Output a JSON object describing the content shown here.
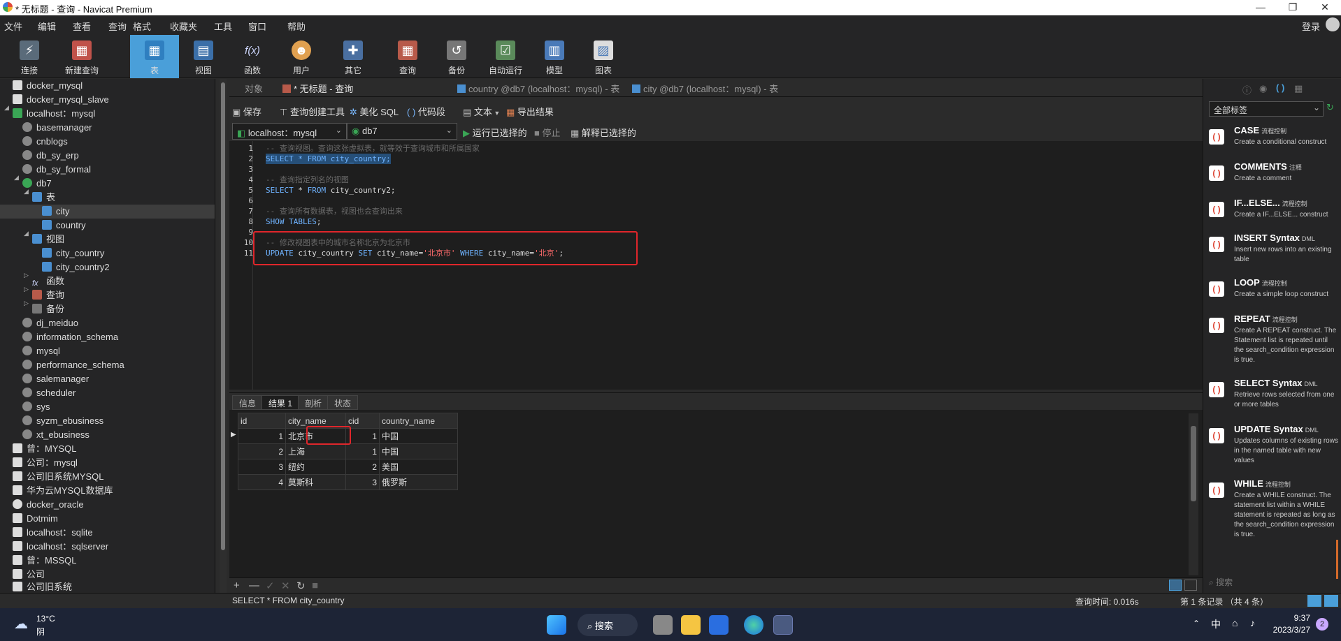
{
  "window": {
    "title": "* 无标题 - 查询 - Navicat Premium",
    "controls": [
      "—",
      "❐",
      "✕"
    ]
  },
  "menubar": {
    "items": [
      "文件",
      "编辑",
      "查看",
      "查询",
      "格式",
      "收藏夹",
      "工具",
      "窗口",
      "帮助"
    ],
    "login": "登录"
  },
  "toolbar": {
    "items": [
      {
        "label": "连接",
        "icon": "plug-icon"
      },
      {
        "label": "新建查询",
        "icon": "new-query-icon"
      },
      {
        "label": "表",
        "icon": "table-icon"
      },
      {
        "label": "视图",
        "icon": "view-icon"
      },
      {
        "label": "函数",
        "icon": "function-icon",
        "glyph": "f(x)"
      },
      {
        "label": "用户",
        "icon": "user-icon"
      },
      {
        "label": "其它",
        "icon": "tools-icon"
      },
      {
        "label": "查询",
        "icon": "query-icon"
      },
      {
        "label": "备份",
        "icon": "backup-icon"
      },
      {
        "label": "自动运行",
        "icon": "automation-icon"
      },
      {
        "label": "模型",
        "icon": "model-icon"
      },
      {
        "label": "图表",
        "icon": "chart-icon"
      }
    ]
  },
  "sidebar": {
    "items": [
      {
        "label": "docker_mysql"
      },
      {
        "label": "docker_mysql_slave"
      },
      {
        "label": "localhost：mysql"
      },
      {
        "label": "basemanager"
      },
      {
        "label": "cnblogs"
      },
      {
        "label": "db_sy_erp"
      },
      {
        "label": "db_sy_formal"
      },
      {
        "label": "db7"
      },
      {
        "label": "表"
      },
      {
        "label": "city"
      },
      {
        "label": "country"
      },
      {
        "label": "视图"
      },
      {
        "label": "city_country"
      },
      {
        "label": "city_country2"
      },
      {
        "label": "函数"
      },
      {
        "label": "查询"
      },
      {
        "label": "备份"
      },
      {
        "label": "dj_meiduo"
      },
      {
        "label": "information_schema"
      },
      {
        "label": "mysql"
      },
      {
        "label": "performance_schema"
      },
      {
        "label": "salemanager"
      },
      {
        "label": "scheduler"
      },
      {
        "label": "sys"
      },
      {
        "label": "syzm_ebusiness"
      },
      {
        "label": "xt_ebusiness"
      },
      {
        "label": "曾：MYSQL"
      },
      {
        "label": "公司：mysql"
      },
      {
        "label": "公司旧系统MYSQL"
      },
      {
        "label": "华为云MYSQL数据库"
      },
      {
        "label": "docker_oracle"
      },
      {
        "label": "Dotmim"
      },
      {
        "label": "localhost：sqlite"
      },
      {
        "label": "localhost：sqlserver"
      },
      {
        "label": "曾：MSSQL"
      },
      {
        "label": "公司"
      },
      {
        "label": "公司旧系统"
      }
    ]
  },
  "tabs": {
    "objects": "对象",
    "query": "* 无标题 - 查询",
    "country": "country @db7 (localhost：mysql) - 表",
    "city": "city @db7 (localhost：mysql) - 表"
  },
  "editor_toolbar": {
    "save": "保存",
    "query_builder": "查询创建工具",
    "beautify": "美化 SQL",
    "snippet": "代码段",
    "text": "文本",
    "export": "导出结果"
  },
  "connection_bar": {
    "connection": "localhost：mysql",
    "database": "db7",
    "run_selected": "运行已选择的",
    "stop": "停止",
    "explain": "解释已选择的"
  },
  "editor": {
    "line_numbers": [
      "1",
      "2",
      "3",
      "4",
      "5",
      "6",
      "7",
      "8",
      "9",
      "10",
      "11"
    ],
    "lines": {
      "l1": "-- 查询视图。查询这张虚拟表，就等效于查询城市和所属国家",
      "l2": "SELECT * FROM city_country;",
      "l4": "-- 查询指定列名的视图",
      "l5a": "SELECT",
      "l5b": " * ",
      "l5c": "FROM",
      "l5d": " city_country2;",
      "l7": "-- 查询所有数据表，视图也会查询出来",
      "l8a": "SHOW TABLES",
      "l8b": ";",
      "l10": "-- 修改视图表中的城市名称北京为北京市",
      "l11a": "UPDATE",
      "l11b": " city_country ",
      "l11c": "SET",
      "l11d": " city_name=",
      "l11e": "'北京市'",
      "l11f": " WHERE",
      "l11g": " city_name=",
      "l11h": "'北京'",
      "l11i": ";"
    }
  },
  "result_tabs": [
    "信息",
    "结果 1",
    "剖析",
    "状态"
  ],
  "result_table": {
    "columns": [
      "id",
      "city_name",
      "cid",
      "country_name"
    ],
    "rows": [
      [
        "1",
        "北京市",
        "1",
        "中国"
      ],
      [
        "2",
        "上海",
        "1",
        "中国"
      ],
      [
        "3",
        "纽约",
        "2",
        "美国"
      ],
      [
        "4",
        "莫斯科",
        "3",
        "俄罗斯"
      ]
    ]
  },
  "grid_controls": [
    "+",
    "—",
    "✓",
    "✕",
    "↻",
    "■"
  ],
  "statusbar": {
    "sql": "SELECT * FROM city_country",
    "query_time": "查询时间: 0.016s",
    "record_info": "第 1 条记录 （共 4 条）"
  },
  "right_panel": {
    "filter": "全部标签",
    "search_placeholder": "搜索",
    "snippets": [
      {
        "title": "CASE",
        "category": "流程控制",
        "desc": "Create a conditional construct"
      },
      {
        "title": "COMMENTS",
        "category": "注释",
        "desc": "Create a comment"
      },
      {
        "title": "IF...ELSE...",
        "category": "流程控制",
        "desc": "Create a IF...ELSE... construct"
      },
      {
        "title": "INSERT Syntax",
        "category": "DML",
        "desc": "Insert new rows into an existing table"
      },
      {
        "title": "LOOP",
        "category": "流程控制",
        "desc": "Create a simple loop construct"
      },
      {
        "title": "REPEAT",
        "category": "流程控制",
        "desc": "Create A REPEAT construct. The Statement list is repeated until the search_condition expression is true."
      },
      {
        "title": "SELECT Syntax",
        "category": "DML",
        "desc": "Retrieve rows selected from one or more tables"
      },
      {
        "title": "UPDATE Syntax",
        "category": "DML",
        "desc": "Updates columns of existing rows in the named table with new values"
      },
      {
        "title": "WHILE",
        "category": "流程控制",
        "desc": "Create a WHILE construct. The statement list within a WHILE statement is repeated as long as the search_condition expression is true."
      }
    ]
  },
  "taskbar": {
    "weather_temp": "13°C",
    "weather_desc": "阴",
    "search": "搜索",
    "ime": "中",
    "time": "9:37",
    "date": "2023/3/27",
    "notifications": "2"
  },
  "colors": {
    "accent": "#4a9fd9",
    "highlight_box": "#e0262b",
    "keyword": "#6fb3ff",
    "string": "#ff6b6b",
    "comment": "#6a6a6a"
  }
}
